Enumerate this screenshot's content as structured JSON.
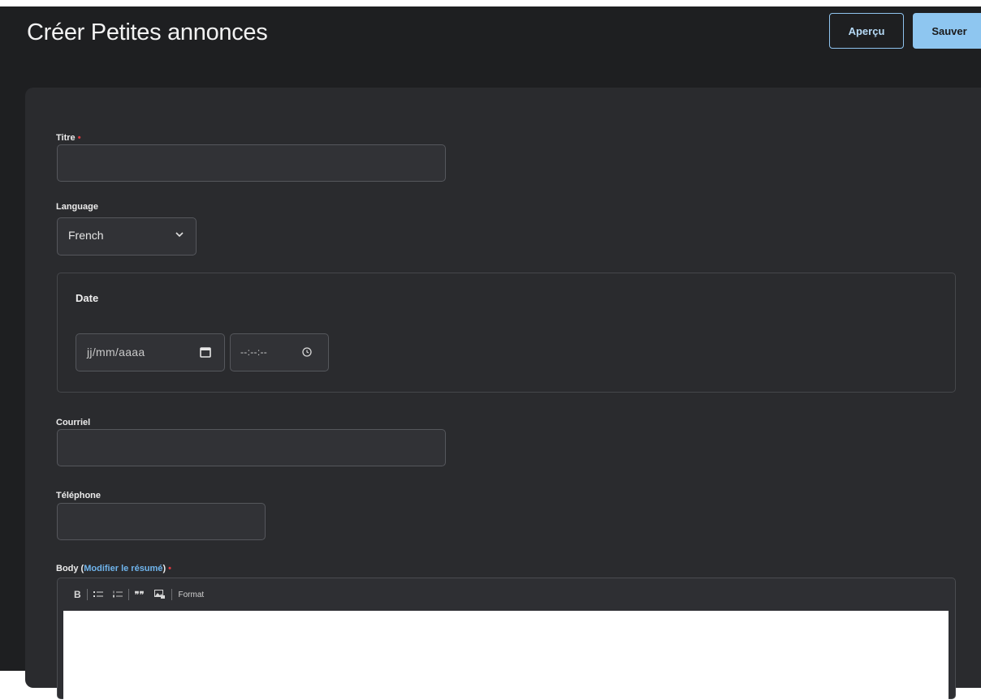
{
  "header": {
    "title": "Créer Petites annonces",
    "preview_label": "Aperçu",
    "save_label": "Sauver"
  },
  "form": {
    "title_label": "Titre",
    "required_mark": "•",
    "title_value": "",
    "language_label": "Language",
    "language_value": "French",
    "date_section_title": "Date",
    "date_placeholder": "jj/mm/aaaa",
    "time_placeholder": "--:--:--",
    "email_label": "Courriel",
    "email_value": "",
    "phone_label": "Téléphone",
    "phone_value": "",
    "body_label_prefix": "Body (",
    "body_link": "Modifier le résumé",
    "body_label_suffix": ")",
    "toolbar": {
      "bold": "B",
      "bullets_icon": "bulleted-list-icon",
      "numbers_icon": "numbered-list-icon",
      "quote": "❞❞",
      "image_icon": "image-icon",
      "format_label": "Format"
    }
  },
  "colors": {
    "background": "#1e1f21",
    "card": "#2a2b2e",
    "accent": "#8ec6f0",
    "required": "#e0383e",
    "link": "#6fb4ec"
  }
}
